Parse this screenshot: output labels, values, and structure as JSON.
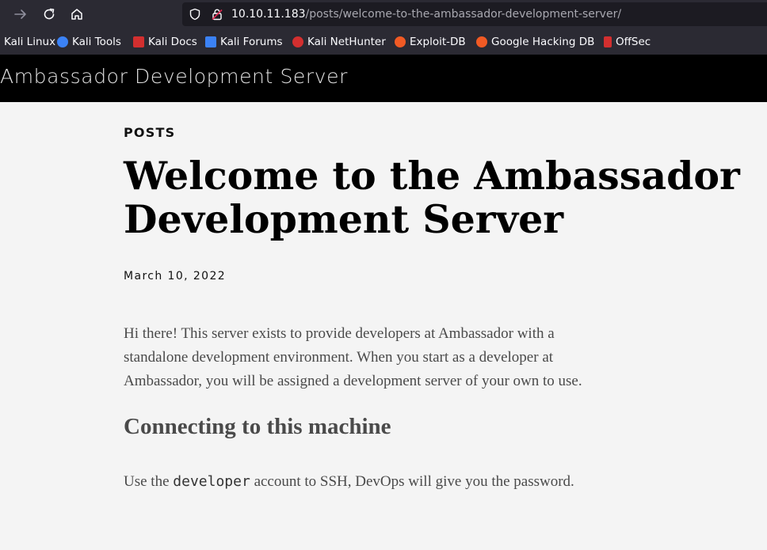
{
  "browser": {
    "url_host": "10.10.11.183",
    "url_path": "/posts/welcome-to-the-ambassador-development-server/",
    "icons": {
      "forward": "forward-arrow-icon",
      "reload": "reload-icon",
      "home": "home-icon",
      "shield": "shield-icon",
      "lock": "insecure-lock-icon"
    }
  },
  "bookmarks": [
    {
      "label": "Kali Linux",
      "icon": "kali-linux-icon",
      "color": "#2b2a33"
    },
    {
      "label": "Kali Tools",
      "icon": "kali-tools-icon",
      "color": "#3b82f6"
    },
    {
      "label": "Kali Docs",
      "icon": "kali-docs-icon",
      "color": "#d32f2f"
    },
    {
      "label": "Kali Forums",
      "icon": "kali-forums-icon",
      "color": "#3b82f6"
    },
    {
      "label": "Kali NetHunter",
      "icon": "kali-nethunter-icon",
      "color": "#d32f2f"
    },
    {
      "label": "Exploit-DB",
      "icon": "exploit-db-icon",
      "color": "#f15a24"
    },
    {
      "label": "Google Hacking DB",
      "icon": "google-hacking-db-icon",
      "color": "#f15a24"
    },
    {
      "label": "OffSec",
      "icon": "offsec-icon",
      "color": "#d32f2f"
    }
  ],
  "site": {
    "title": "Ambassador Development Server"
  },
  "post": {
    "kicker": "POSTS",
    "title": "Welcome to the Ambassador Development Server",
    "date": "March 10, 2022",
    "paragraph1": "Hi there! This server exists to provide developers at Ambassador with a standalone development environment. When you start as a developer at Ambassador, you will be assigned a development server of your own to use.",
    "heading": "Connecting to this machine",
    "paragraph2_before": "Use the ",
    "paragraph2_code": "developer",
    "paragraph2_after": " account to SSH, DevOps will give you the password."
  },
  "colors": {
    "chrome": "#2b2a33",
    "urlbar": "#1c1b22",
    "header": "#000000",
    "page": "#f4f4f4"
  }
}
